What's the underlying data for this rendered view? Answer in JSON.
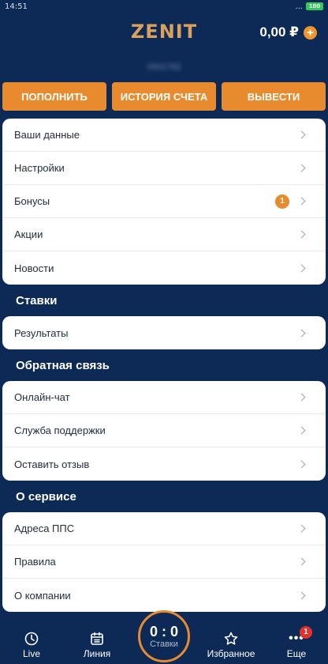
{
  "status_bar": {
    "time": "14:51",
    "signal": "... ",
    "battery": "100"
  },
  "header": {
    "logo": "ZENIT",
    "balance": "0,00 ₽",
    "add_label": "+"
  },
  "account": {
    "id": "0501782"
  },
  "actions": [
    {
      "label": "ПОПОЛНИТЬ"
    },
    {
      "label": "ИСТОРИЯ СЧЕТА"
    },
    {
      "label": "ВЫВЕСТИ"
    }
  ],
  "account_menu": [
    {
      "label": "Ваши данные"
    },
    {
      "label": "Настройки"
    },
    {
      "label": "Бонусы",
      "badge": "1"
    },
    {
      "label": "Акции"
    },
    {
      "label": "Новости"
    }
  ],
  "sections": {
    "bets": {
      "title": "Ставки",
      "items": [
        {
          "label": "Результаты"
        }
      ]
    },
    "feedback": {
      "title": "Обратная связь",
      "items": [
        {
          "label": "Онлайн-чат"
        },
        {
          "label": "Служба поддержки"
        },
        {
          "label": "Оставить отзыв"
        }
      ]
    },
    "service": {
      "title": "О сервисе",
      "items": [
        {
          "label": "Адреса ППС"
        },
        {
          "label": "Правила"
        },
        {
          "label": "О компании"
        }
      ]
    }
  },
  "tabbar": {
    "live": "Live",
    "line": "Линия",
    "score": "0 : 0",
    "bets": "Ставки",
    "favorites": "Избранное",
    "more": "Еще",
    "more_dots": "•••",
    "more_badge": "1"
  },
  "colors": {
    "background": "#0d2a57",
    "accent": "#e88a2e",
    "logo": "#d9a15c",
    "badge_red": "#e0312c"
  }
}
